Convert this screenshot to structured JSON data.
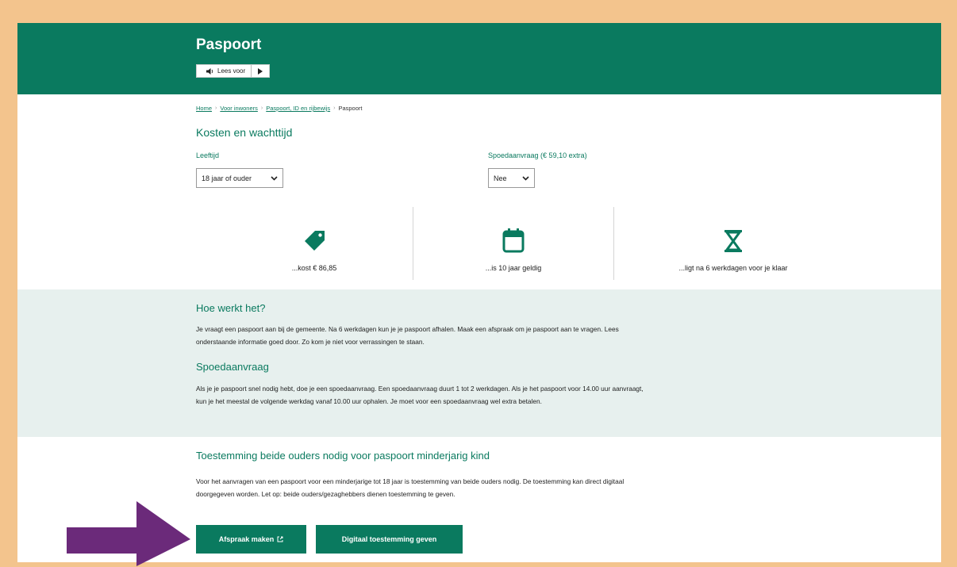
{
  "header": {
    "title": "Paspoort",
    "readspeaker_label": "Lees voor"
  },
  "breadcrumb": {
    "items": [
      "Home",
      "Voor inwoners",
      "Paspoort, ID en rijbewijs"
    ],
    "current": "Paspoort"
  },
  "costs": {
    "title": "Kosten en wachttijd",
    "age_label": "Leeftijd",
    "age_value": "18 jaar of ouder",
    "rush_label": "Spoedaanvraag (€ 59,10 extra)",
    "rush_value": "Nee",
    "items": [
      {
        "icon": "price-tag-icon",
        "text": "...kost € 86,85"
      },
      {
        "icon": "calendar-icon",
        "text": "...is 10 jaar geldig"
      },
      {
        "icon": "hourglass-icon",
        "text": "...ligt na 6 werkdagen voor je klaar"
      }
    ]
  },
  "how": {
    "title": "Hoe werkt het?",
    "text": "Je vraagt een paspoort aan bij de gemeente. Na 6 werkdagen kun je je paspoort afhalen. Maak een afspraak om je paspoort aan te vragen. Lees onderstaande informatie goed door. Zo kom je niet voor verrassingen te staan."
  },
  "rush": {
    "title": "Spoedaanvraag",
    "text": "Als je je paspoort snel nodig hebt, doe je een spoedaanvraag. Een spoedaanvraag duurt 1 tot 2 werkdagen. Als je het paspoort voor 14.00 uur aanvraagt, kun je het meestal de volgende werkdag vanaf 10.00 uur ophalen. Je moet voor een spoedaanvraag wel extra betalen."
  },
  "consent": {
    "title": "Toestemming beide ouders nodig voor paspoort minderjarig kind",
    "text": "Voor het aanvragen van een paspoort voor een minderjarige tot 18 jaar is toestemming van beide ouders nodig. De toestemming kan direct digitaal doorgegeven worden. Let op: beide ouders/gezaghebbers dienen toestemming te geven."
  },
  "buttons": {
    "appointment": "Afspraak maken",
    "digital_consent": "Digitaal toestemming geven"
  },
  "colors": {
    "brand": "#0a7a5f",
    "border": "#f3c48d",
    "band": "#e7f0ee",
    "arrow": "#6b2a7a"
  }
}
